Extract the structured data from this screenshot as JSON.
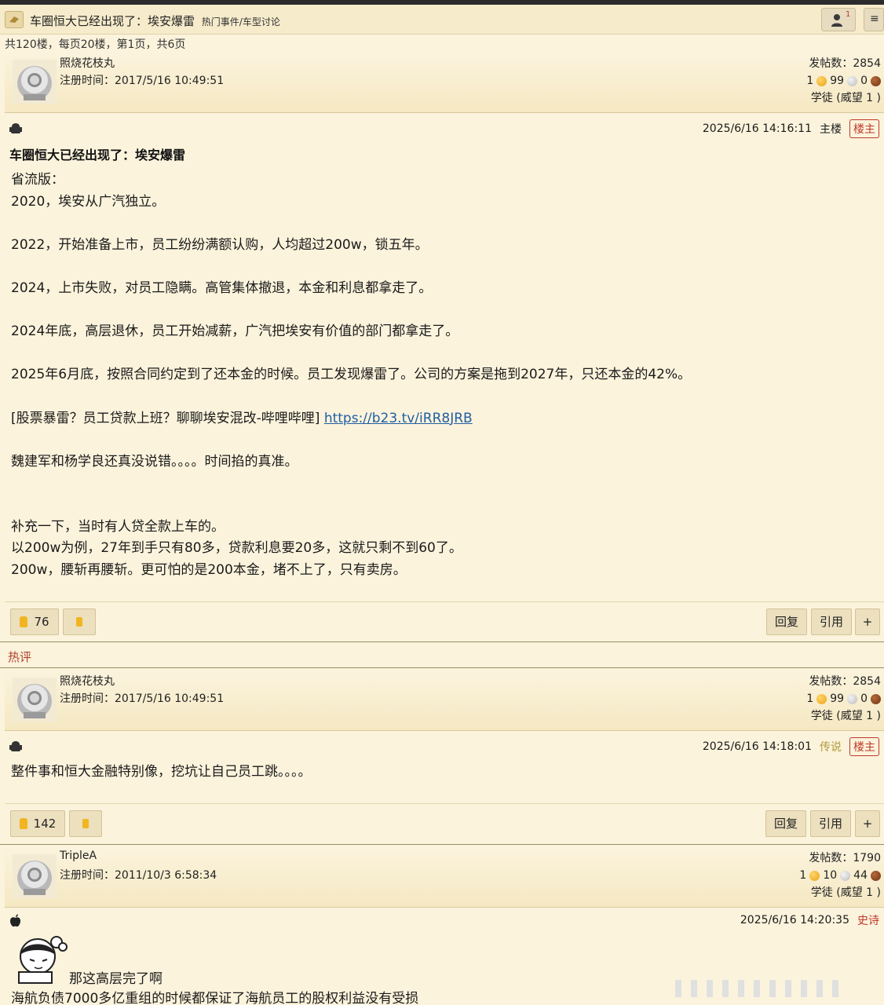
{
  "header": {
    "title": "车圈恒大已经出现了：埃安爆雷",
    "category": "热门事件/车型讨论",
    "notification_count": "1"
  },
  "pagination": {
    "info": "共120楼，每页20楼，第1页，共6页"
  },
  "posts": [
    {
      "user": {
        "name": "照烧花枝丸",
        "reg_time": "注册时间：2017/5/16 10:49:51",
        "posts": "发帖数：2854",
        "gold": "1",
        "silver": "99",
        "bronze": "0",
        "title": "学徒 (威望 1 )"
      },
      "time": "2025/6/16 14:16:11",
      "floor": "主楼",
      "op_tag": "楼主",
      "title": "车圈恒大已经出现了：埃安爆雷",
      "lines": [
        "省流版：",
        "2020，埃安从广汽独立。",
        "",
        "2022，开始准备上市，员工纷纷满额认购，人均超过200w，锁五年。",
        "",
        "2024，上市失败，对员工隐瞒。高管集体撤退，本金和利息都拿走了。",
        "",
        "2024年底，高层退休，员工开始减薪，广汽把埃安有价值的部门都拿走了。",
        "",
        "2025年6月底，按照合同约定到了还本金的时候。员工发现爆雷了。公司的方案是拖到2027年，只还本金的42%。",
        "",
        "[股票暴雷？员工贷款上班？聊聊埃安混改-哔哩哔哩] ",
        "",
        "魏建军和杨学良还真没说错。。。。时间掐的真准。",
        "",
        "",
        "补充一下，当时有人贷全款上车的。",
        "以200w为例，27年到手只有80多，贷款利息要20多，这就只剩不到60了。",
        "200w，腰斩再腰斩。更可怕的是200本金，堵不上了，只有卖房。"
      ],
      "link_text": "https://b23.tv/iRR8JRB",
      "likes": "76",
      "reply_label": "回复",
      "quote_label": "引用",
      "plus_label": "+"
    },
    {
      "section_label": "热评",
      "user": {
        "name": "照烧花枝丸",
        "reg_time": "注册时间：2017/5/16 10:49:51",
        "posts": "发帖数：2854",
        "gold": "1",
        "silver": "99",
        "bronze": "0",
        "title": "学徒 (威望 1 )"
      },
      "time": "2025/6/16 14:18:01",
      "rank": "传说",
      "op_tag": "楼主",
      "text": "整件事和恒大金融特别像，挖坑让自己员工跳。。。。",
      "likes": "142",
      "reply_label": "回复",
      "quote_label": "引用",
      "plus_label": "+"
    },
    {
      "user": {
        "name": "TripleA",
        "reg_time": "注册时间：2011/10/3 6:58:34",
        "posts": "发帖数：1790",
        "gold": "1",
        "silver": "10",
        "bronze": "44",
        "title": "学徒 (威望 1 )"
      },
      "time": "2025/6/16 14:20:35",
      "rank": "史诗",
      "text1": "那这高层完了啊",
      "text2": "海航负债7000多亿重组的时候都保证了海航员工的股权利益没有受损"
    }
  ],
  "colors": {
    "background": "#fbf3dc",
    "op_tag": "#c0392b",
    "link": "#1f5fa3",
    "legend_rank": "#b39a3a"
  }
}
